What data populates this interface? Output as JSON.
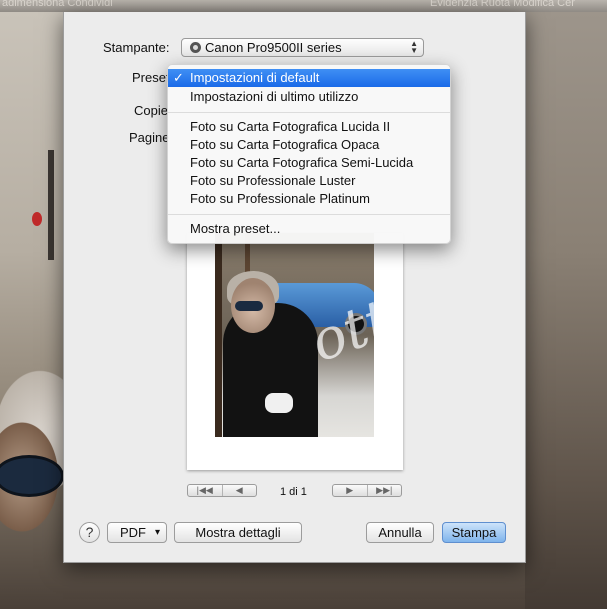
{
  "background": {
    "top_menu_left": "adimensiona  Condividi",
    "top_menu_right": "Evidenzia  Ruota  Modifica  Cer"
  },
  "print_dialog": {
    "printer_label": "Stampante:",
    "printer_value": "Canon Pro9500II series",
    "preset_label": "Preset",
    "copies_label": "Copie",
    "pages_label": "Pagine",
    "pager_text": "1 di 1",
    "help_label": "?",
    "pdf_label": "PDF",
    "pdf_arrow": "▾",
    "details_label": "Mostra dettagli",
    "cancel_label": "Annulla",
    "print_label": "Stampa",
    "pager_prev": [
      "|◀◀",
      "◀"
    ],
    "pager_next": [
      "▶",
      "▶▶|"
    ]
  },
  "preset_menu": {
    "check": "✓",
    "items": [
      {
        "label": "Impostazioni di default",
        "selected": true
      },
      {
        "label": "Impostazioni di ultimo utilizzo",
        "selected": false
      },
      {
        "label": "Foto su Carta Fotografica Lucida II",
        "selected": false
      },
      {
        "label": "Foto su Carta Fotografica Opaca",
        "selected": false
      },
      {
        "label": "Foto su Carta Fotografica Semi-Lucida",
        "selected": false
      },
      {
        "label": "Foto su Professionale Luster",
        "selected": false
      },
      {
        "label": "Foto su Professionale Platinum",
        "selected": false
      },
      {
        "label": "Mostra preset...",
        "selected": false
      }
    ]
  },
  "colors": {
    "highlight": "#1a6ae8",
    "primary_button": "#7fb4ec"
  }
}
